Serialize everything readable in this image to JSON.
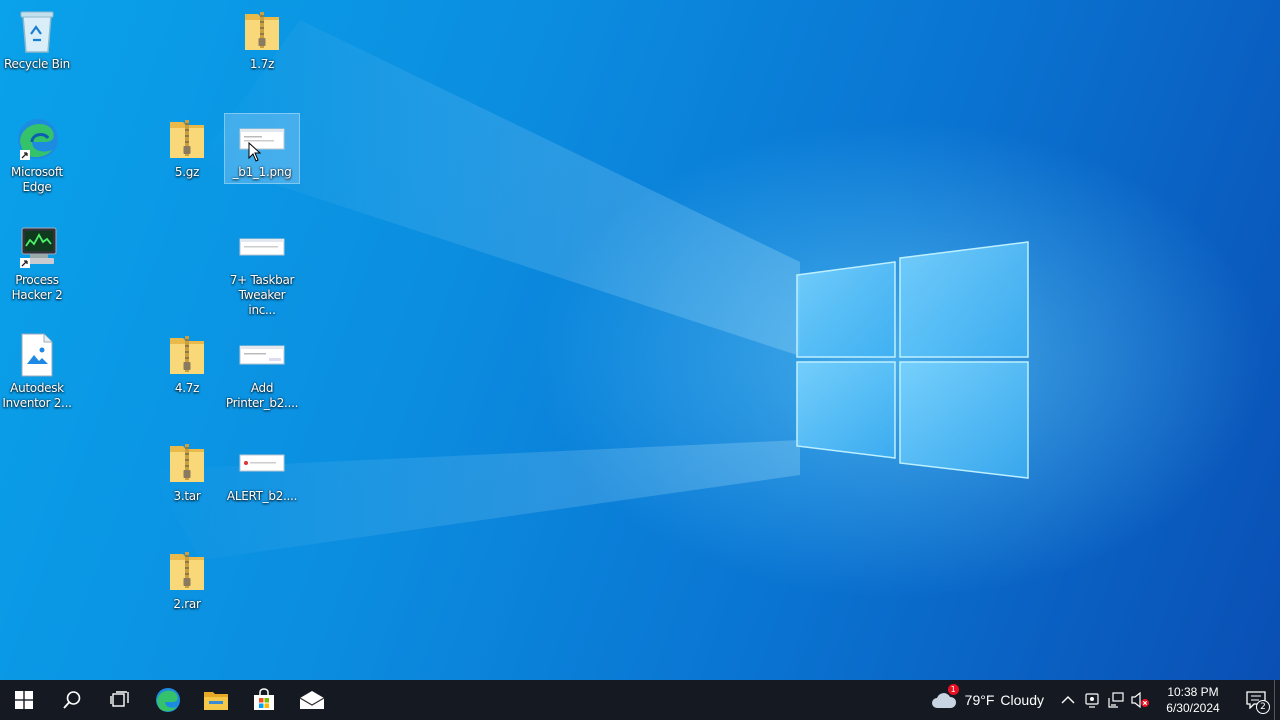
{
  "desktop": {
    "icons": {
      "recycle_bin": "Recycle Bin",
      "edge": "Microsoft Edge",
      "process_hacker": "Process Hacker 2",
      "autodesk": "Autodesk Inventor 2...",
      "file_1_7z": "1.7z",
      "file_5_gz": "5.gz",
      "file_b1_png": "_b1_1.png",
      "file_taskbar_tweaker": "7+ Taskbar Tweaker inc...",
      "file_4_7z": "4.7z",
      "file_add_printer": "Add Printer_b2....",
      "file_3_tar": "3.tar",
      "file_alert": "ALERT_b2....",
      "file_2_rar": "2.rar"
    }
  },
  "taskbar": {
    "weather": {
      "temp": "79°F",
      "condition": "Cloudy",
      "badge": "1"
    },
    "clock": {
      "time": "10:38 PM",
      "date": "6/30/2024"
    },
    "notification_count": "2"
  },
  "colors": {
    "taskbar_bg": "#151a22",
    "accent": "#0a8fe0"
  }
}
